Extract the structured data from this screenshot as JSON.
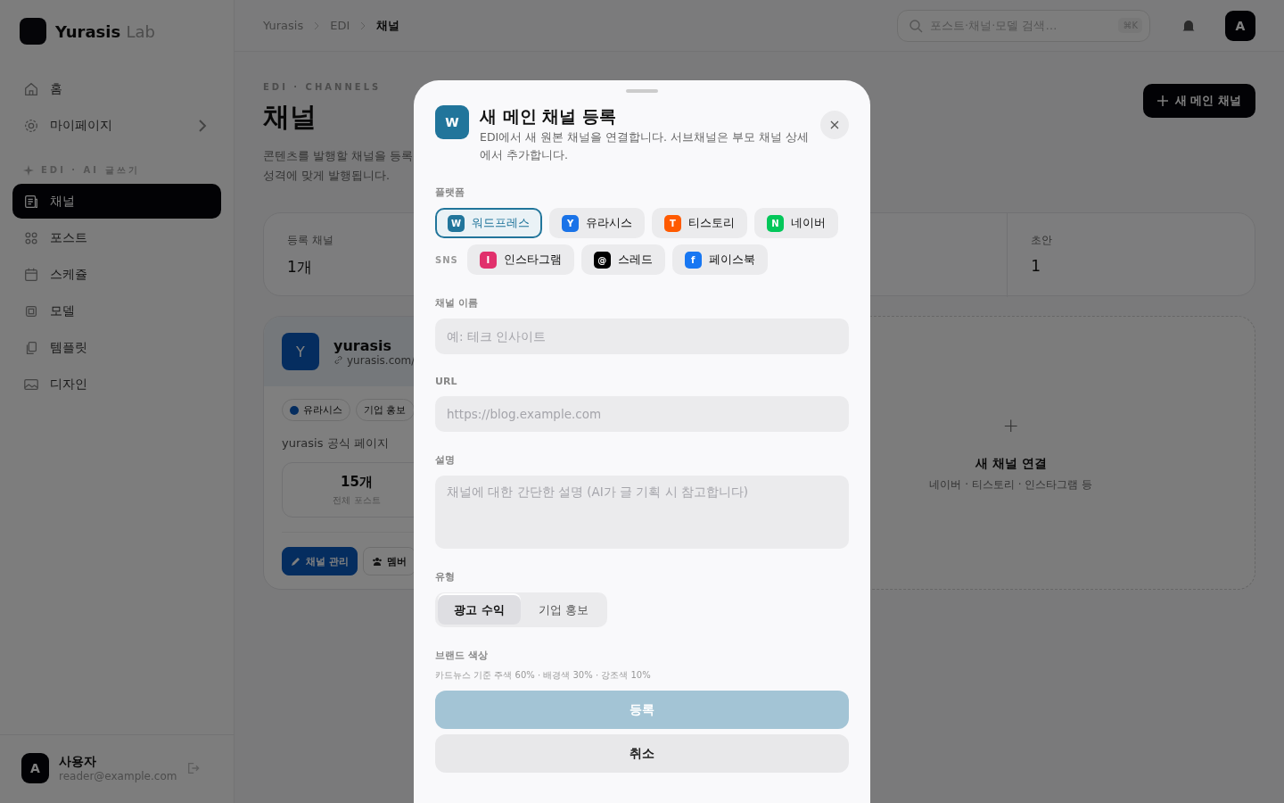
{
  "sidebar": {
    "logo": {
      "name": "Yurasis",
      "suffix": "Lab"
    },
    "items": [
      {
        "label": "홈",
        "selected": false,
        "chevron": false
      },
      {
        "label": "마이페이지",
        "selected": false,
        "chevron": true
      }
    ],
    "section": {
      "label": "EDI · AI 글쓰기"
    },
    "section_items": [
      {
        "label": "채널",
        "selected": true
      },
      {
        "label": "포스트",
        "selected": false
      },
      {
        "label": "스케쥴",
        "selected": false
      },
      {
        "label": "모델",
        "selected": false
      },
      {
        "label": "템플릿",
        "selected": false
      },
      {
        "label": "디자인",
        "selected": false
      }
    ],
    "user": {
      "avatar": "A",
      "name": "사용자",
      "email": "reader@example.com"
    }
  },
  "topbar": {
    "breadcrumb": [
      {
        "label": "Yurasis",
        "selected": false
      },
      {
        "label": "EDI",
        "selected": false
      },
      {
        "label": "채널",
        "selected": true
      }
    ],
    "search": {
      "placeholder": "포스트·채널·모델 검색…",
      "shortcut": "⌘K"
    },
    "avatar": "A"
  },
  "page": {
    "eyebrow": "EDI · CHANNELS",
    "title": "채널",
    "description": [
      "콘텐츠를 발행할 채널을 등록",
      "성격에 맞게 발행됩니다."
    ],
    "new_button": "새 메인 채널",
    "stats": [
      {
        "label": "등록 채널",
        "value": "1개"
      },
      {
        "label": "초안",
        "value": "1"
      }
    ],
    "channel": {
      "avatar": "Y",
      "name": "yurasis",
      "url": "yurasis.com/",
      "tags": [
        {
          "label": "유라시스",
          "kind": "dot"
        },
        {
          "label": "기업 홍보",
          "kind": "plain"
        }
      ],
      "description": "yurasis 공식 페이지",
      "count": "15개",
      "count_label": "전체 포스트",
      "buttons": [
        {
          "label": "채널 관리",
          "kind": "primary"
        },
        {
          "label": "멤버",
          "kind": "secondary"
        }
      ]
    },
    "add_card": {
      "icon": "+",
      "title": "새 채널 연결",
      "subtitle": "네이버 · 티스토리 · 인스타그램 등"
    }
  },
  "modal": {
    "icon": "W",
    "title": "새 메인 채널 등록",
    "subtitle": "EDI에서 새 원본 채널을 연결합니다. 서브채널은 부모 채널 상세에서 추가합니다.",
    "platform_label": "플랫폼",
    "platforms": [
      {
        "badge": "W",
        "label": "워드프레스",
        "color": "#21759b",
        "selected": true
      },
      {
        "badge": "Y",
        "label": "유라시스",
        "color": "#1a73e8",
        "selected": false
      },
      {
        "badge": "T",
        "label": "티스토리",
        "color": "#ff5a00",
        "selected": false
      },
      {
        "badge": "N",
        "label": "네이버",
        "color": "#03c75a",
        "selected": false
      }
    ],
    "sns_label": "SNS",
    "sns": [
      {
        "badge": "I",
        "label": "인스타그램",
        "color": "#e1306c",
        "selected": false
      },
      {
        "badge": "@",
        "label": "스레드",
        "color": "#000000",
        "selected": false
      },
      {
        "badge": "f",
        "label": "페이스북",
        "color": "#1877f2",
        "selected": false
      }
    ],
    "fields": [
      {
        "label": "채널 이름",
        "placeholder": "예: 테크 인사이트",
        "kind": "input"
      },
      {
        "label": "URL",
        "placeholder": "https://blog.example.com",
        "kind": "input"
      },
      {
        "label": "설명",
        "placeholder": "채널에 대한 간단한 설명 (AI가 글 기획 시 참고합니다)",
        "kind": "textarea"
      }
    ],
    "type_label": "유형",
    "types": [
      {
        "label": "광고 수익",
        "selected": true
      },
      {
        "label": "기업 홍보",
        "selected": false
      }
    ],
    "brand_label": "브랜드 색상",
    "brand_hint": "카드뉴스 기준 주색 60% · 배경색 30% · 강조색 10%",
    "submit": {
      "label": "등록",
      "disabled": true
    },
    "cancel": "취소"
  }
}
